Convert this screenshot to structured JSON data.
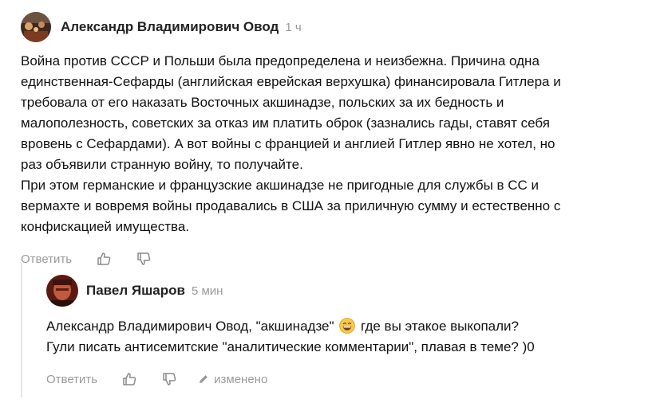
{
  "comment": {
    "author": "Александр Владимирович Овод",
    "time": "1 ч",
    "lines": [
      "Война против СССР и Польши была предопределена и неизбежна. Причина одна",
      "единственная-Сефарды (английская еврейская верхушка) финансировала Гитлера и",
      "требовала от его наказать Восточных акшинадзе, польских за их бедность и",
      "малополезность, советских за отказ им платить оброк (зазнались гады, ставят себя",
      "вровень с Сефардами). А вот войны с францией и англией Гитлер явно не хотел, но",
      "раз объявили странную войну, то получайте.",
      "При этом германские и французские акшинадзе не пригодные для службы в СС и",
      "вермахте и вовремя войны продавались в США за приличную сумму и естественно с",
      "конфискацией имущества."
    ],
    "reply_label": "Ответить"
  },
  "reply": {
    "author": "Павел Яшаров",
    "time": "5 мин",
    "line1_before": "Александр Владимирович Овод, \"акшинадзе\"",
    "line1_after": "где вы этакое выкопали?",
    "line2": "Гули писать антисемитские \"аналитические комментарии\", плавая в теме? )0",
    "reply_label": "Ответить",
    "edited_label": "изменено"
  },
  "icons": {
    "like": "thumbs-up-icon",
    "dislike": "thumbs-down-icon",
    "edit": "pencil-icon",
    "emoji": "grinning-face-emoji"
  },
  "colors": {
    "muted": "#9a9a9a",
    "thread_line": "#e4e4e4",
    "text": "#111111"
  }
}
